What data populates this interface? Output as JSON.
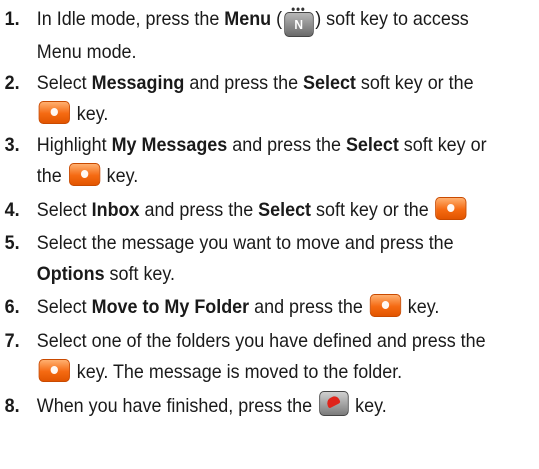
{
  "steps": [
    {
      "number": "1.",
      "pre": "In Idle mode, press the ",
      "bold1": "Menu",
      "mid1": " (",
      "key_menu_label": "N",
      "key_menu_dots": "•••",
      "post1": ") soft key to access",
      "line2": "Menu mode."
    },
    {
      "number": "2.",
      "pre": "Select ",
      "bold1": "Messaging",
      "mid1": " and press the ",
      "bold2": "Select",
      "post1": " soft key or the",
      "line2_after_key": " key."
    },
    {
      "number": "3.",
      "pre": "Highlight ",
      "bold1": "My Messages",
      "mid1": " and press the ",
      "bold2": "Select",
      "post1": " soft key or",
      "line2_pre": "the ",
      "line2_after_key": " key."
    },
    {
      "number": "4.",
      "pre": "Select ",
      "bold1": "Inbox",
      "mid1": " and press the ",
      "bold2": "Select",
      "post1": " soft key or the "
    },
    {
      "number": "5.",
      "pre": "Select the message you want to move and press the",
      "line2_bold": "Options",
      "line2_post": " soft key."
    },
    {
      "number": "6.",
      "pre": "Select ",
      "bold1": "Move to My Folder",
      "mid1": " and press the ",
      "post1": " key."
    },
    {
      "number": "7.",
      "pre": "Select one of the folders you have defined and press the",
      "line2_after_key": " key. The message is moved to the folder."
    },
    {
      "number": "8.",
      "pre": "When you have finished, press the ",
      "post1": " key."
    }
  ],
  "icons": {
    "select_key": "orange-select-key-icon",
    "menu_key": "menu-soft-key-icon",
    "end_key": "red-end-key-icon"
  },
  "colors": {
    "select_key": "#f56a12",
    "end_key_phone": "#e0241b"
  }
}
